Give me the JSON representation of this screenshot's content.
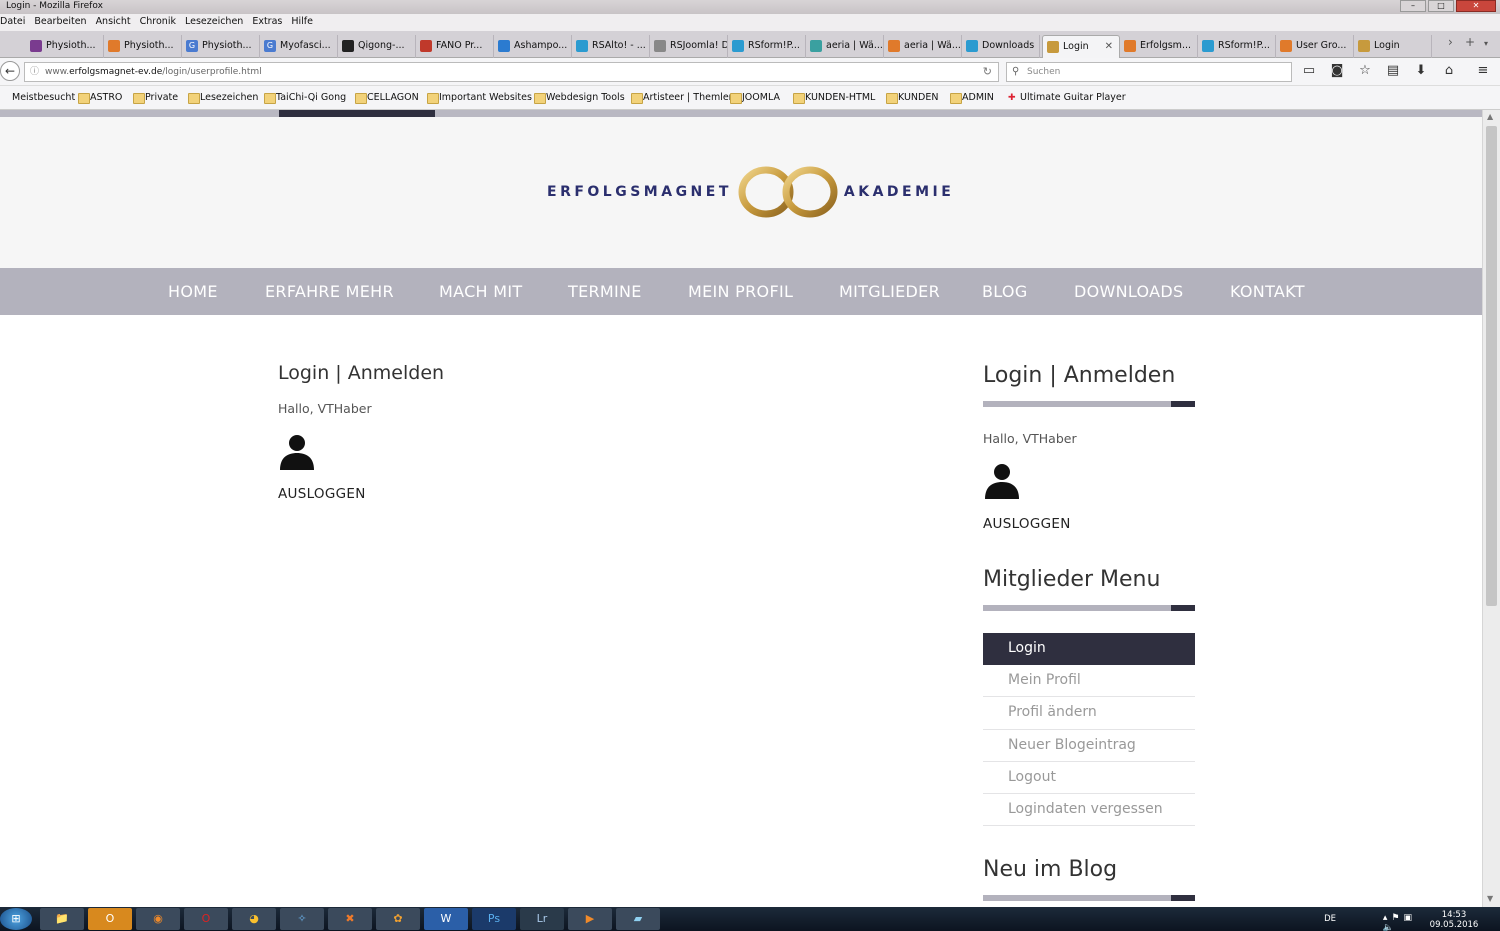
{
  "window": {
    "title": "Login - Mozilla Firefox",
    "menu": [
      "Datei",
      "Bearbeiten",
      "Ansicht",
      "Chronik",
      "Lesezeichen",
      "Extras",
      "Hilfe"
    ]
  },
  "tabs": [
    {
      "label": "Physioth...",
      "fav_color": "#7a3b8f"
    },
    {
      "label": "Physioth...",
      "fav_color": "#e07a2b"
    },
    {
      "label": "Physioth...",
      "fav_color": "#4a7bd0",
      "fav": "G"
    },
    {
      "label": "Myofasci...",
      "fav_color": "#4a7bd0",
      "fav": "G"
    },
    {
      "label": "Qigong-...",
      "fav_color": "#222"
    },
    {
      "label": "FANO Pr...",
      "fav_color": "#c0392b"
    },
    {
      "label": "Ashampo...",
      "fav_color": "#2b7bd0"
    },
    {
      "label": "RSAlto! - ...",
      "fav_color": "#2b9bd0"
    },
    {
      "label": "RSJoomla! De...",
      "fav_color": "#888"
    },
    {
      "label": "RSform!P...",
      "fav_color": "#2b9bd0"
    },
    {
      "label": "aeria | Wä...",
      "fav_color": "#3aa0a0"
    },
    {
      "label": "aeria | Wä...",
      "fav_color": "#e07a2b"
    },
    {
      "label": "Downloads",
      "fav_color": "#2b9bd0"
    },
    {
      "label": "Login",
      "fav_color": "#c79a3d",
      "active": true
    },
    {
      "label": "Erfolgsm...",
      "fav_color": "#e07a2b"
    },
    {
      "label": "RSform!P...",
      "fav_color": "#2b9bd0"
    },
    {
      "label": "User Gro...",
      "fav_color": "#e07a2b"
    },
    {
      "label": "Login",
      "fav_color": "#c79a3d"
    }
  ],
  "url": {
    "prefix": "www.",
    "domain": "erfolgsmagnet-ev.de",
    "path": "/login/userprofile.html"
  },
  "search_placeholder": "Suchen",
  "bookmarks": [
    "Meistbesucht",
    "ASTRO",
    "Private",
    "Lesezeichen",
    "TaiChi-Qi Gong",
    "CELLAGON",
    "Important Websites",
    "Webdesign Tools",
    "Artisteer | Themler",
    "JOOMLA",
    "KUNDEN-HTML",
    "KUNDEN",
    "ADMIN",
    "Ultimate Guitar Player"
  ],
  "site": {
    "logo_left": "ERFOLGSMAGNET",
    "logo_right": "AKADEMIE",
    "nav": [
      "HOME",
      "ERFAHRE MEHR",
      "MACH MIT",
      "TERMINE",
      "MEIN PROFIL",
      "MITGLIEDER",
      "BLOG",
      "DOWNLOADS",
      "KONTAKT"
    ],
    "main": {
      "title": "Login | Anmelden",
      "greeting": "Hallo, VTHaber",
      "logout": "AUSLOGGEN"
    },
    "sidebar": {
      "login_title": "Login | Anmelden",
      "greeting": "Hallo, VTHaber",
      "logout": "AUSLOGGEN",
      "menu_title": "Mitglieder Menu",
      "menu": [
        "Login",
        "Mein Profil",
        "Profil ändern",
        "Neuer Blogeintrag",
        "Logout",
        "Logindaten vergessen"
      ],
      "blog_title": "Neu im Blog"
    },
    "colors": {
      "brand": "#2b2f6e",
      "gold": "#c79a3d",
      "nav_bg": "#b3b2bd",
      "dark": "#2f2f3f"
    }
  },
  "taskbar": {
    "lang": "DE",
    "time": "14:53",
    "date": "09.05.2016"
  }
}
